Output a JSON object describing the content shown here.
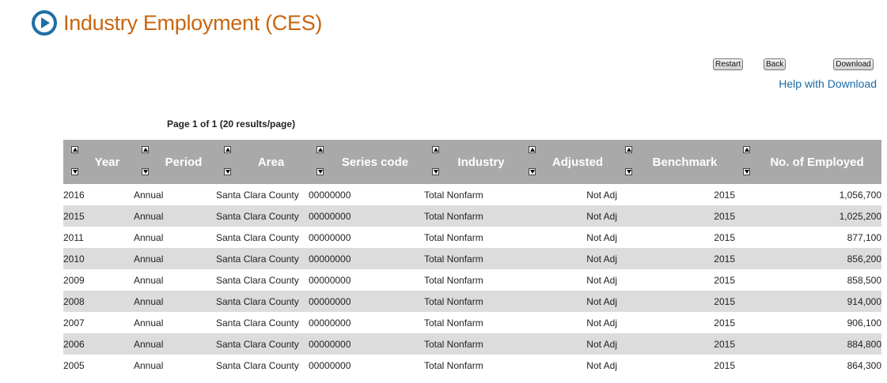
{
  "header": {
    "title": "Industry Employment (CES)"
  },
  "toolbar": {
    "restart": "Restart",
    "back": "Back",
    "download": "Download",
    "help": "Help with Download"
  },
  "paging": {
    "text": "Page 1 of 1 (20 results/page)"
  },
  "columns": [
    "Year",
    "Period",
    "Area",
    "Series code",
    "Industry",
    "Adjusted",
    "Benchmark",
    "No. of Employed"
  ],
  "rows": [
    [
      "2016",
      "Annual",
      "Santa Clara County",
      "00000000",
      "Total Nonfarm",
      "Not Adj",
      "2015",
      "1,056,700"
    ],
    [
      "2015",
      "Annual",
      "Santa Clara County",
      "00000000",
      "Total Nonfarm",
      "Not Adj",
      "2015",
      "1,025,200"
    ],
    [
      "2011",
      "Annual",
      "Santa Clara County",
      "00000000",
      "Total Nonfarm",
      "Not Adj",
      "2015",
      "877,100"
    ],
    [
      "2010",
      "Annual",
      "Santa Clara County",
      "00000000",
      "Total Nonfarm",
      "Not Adj",
      "2015",
      "856,200"
    ],
    [
      "2009",
      "Annual",
      "Santa Clara County",
      "00000000",
      "Total Nonfarm",
      "Not Adj",
      "2015",
      "858,500"
    ],
    [
      "2008",
      "Annual",
      "Santa Clara County",
      "00000000",
      "Total Nonfarm",
      "Not Adj",
      "2015",
      "914,000"
    ],
    [
      "2007",
      "Annual",
      "Santa Clara County",
      "00000000",
      "Total Nonfarm",
      "Not Adj",
      "2015",
      "906,100"
    ],
    [
      "2006",
      "Annual",
      "Santa Clara County",
      "00000000",
      "Total Nonfarm",
      "Not Adj",
      "2015",
      "884,800"
    ],
    [
      "2005",
      "Annual",
      "Santa Clara County",
      "00000000",
      "Total Nonfarm",
      "Not Adj",
      "2015",
      "864,300"
    ]
  ],
  "colors": {
    "title": "#c8660e",
    "accent": "#1f6fa5",
    "header_bg": "#a9a9a9",
    "stripe": "#dcdcdc",
    "link": "#1a6aa6"
  },
  "icons": {
    "title_icon": "play-circle-icon",
    "sort_up": "sort-ascending-icon",
    "sort_down": "sort-descending-icon"
  }
}
